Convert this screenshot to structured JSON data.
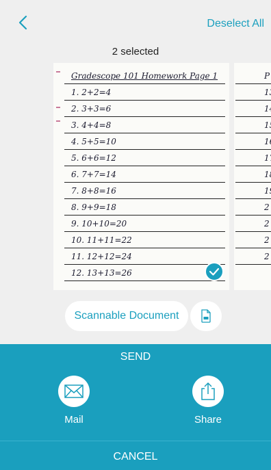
{
  "header": {
    "deselect_label": "Deselect All",
    "selected_count": "2 selected"
  },
  "page1": {
    "title": "Gradescope 101 Homework   Page 1",
    "lines": [
      "1. 2+2=4",
      "2. 3+3=6",
      "3. 4+4=8",
      "4. 5+5=10",
      "5. 6+6=12",
      "6. 7+7=14",
      "7. 8+8=16",
      "8. 9+9=18",
      "9. 10+10=20",
      "10. 11+11=22",
      "11. 12+12=24",
      "12. 13+13=26"
    ]
  },
  "page2": {
    "title": "P",
    "lines": [
      "13",
      "14",
      "15",
      "16",
      "17",
      "18",
      "19",
      "2",
      "2",
      "2",
      "2"
    ]
  },
  "document_type": {
    "label": "Scannable Document",
    "pdf_icon_label": "PDF"
  },
  "actions": {
    "send_label": "SEND",
    "mail_label": "Mail",
    "share_label": "Share",
    "cancel_label": "CANCEL"
  },
  "colors": {
    "accent": "#1a9fbe",
    "background": "#efefef"
  }
}
